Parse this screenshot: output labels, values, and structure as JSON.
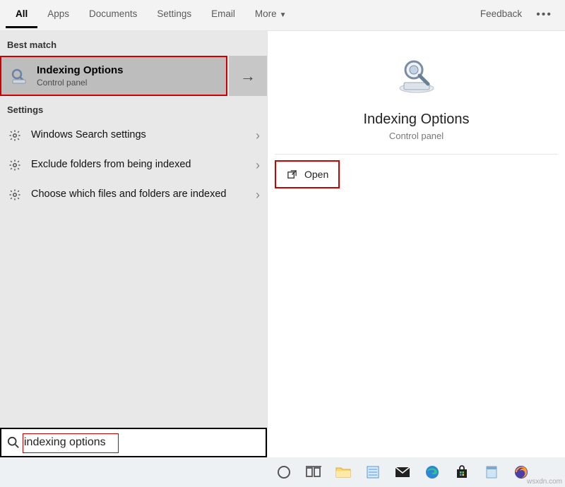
{
  "tabs": {
    "all": "All",
    "apps": "Apps",
    "documents": "Documents",
    "settings": "Settings",
    "email": "Email",
    "more": "More",
    "feedback": "Feedback"
  },
  "left": {
    "best_match_label": "Best match",
    "result": {
      "title": "Indexing Options",
      "subtitle": "Control panel"
    },
    "settings_label": "Settings",
    "settings_items": [
      {
        "label": "Windows Search settings"
      },
      {
        "label": "Exclude folders from being indexed"
      },
      {
        "label": "Choose which files and folders are indexed"
      }
    ]
  },
  "preview": {
    "title": "Indexing Options",
    "subtitle": "Control panel",
    "open_label": "Open"
  },
  "search": {
    "value": "indexing options"
  },
  "watermark": "wsxdn.com"
}
